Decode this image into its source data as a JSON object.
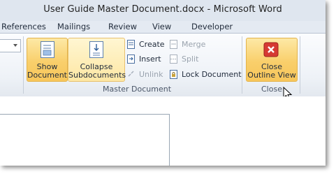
{
  "window": {
    "title": "User Guide Master Document.docx  -  Microsoft Word"
  },
  "tabs": [
    "References",
    "Mailings",
    "Review",
    "View",
    "Developer"
  ],
  "master_document_group": {
    "label": "Master Document",
    "show_document": {
      "line1": "Show",
      "line2": "Document"
    },
    "collapse_subdocuments": {
      "line1": "Collapse",
      "line2": "Subdocuments"
    },
    "create": "Create",
    "insert": "Insert",
    "unlink": "Unlink",
    "merge": "Merge",
    "split": "Split",
    "lock_document": "Lock Document"
  },
  "close_group": {
    "label": "Close",
    "close_outline_view": {
      "line1": "Close",
      "line2": "Outline View"
    }
  },
  "colors": {
    "accent_active": "#f9cf6b",
    "close_red": "#d63a33"
  }
}
